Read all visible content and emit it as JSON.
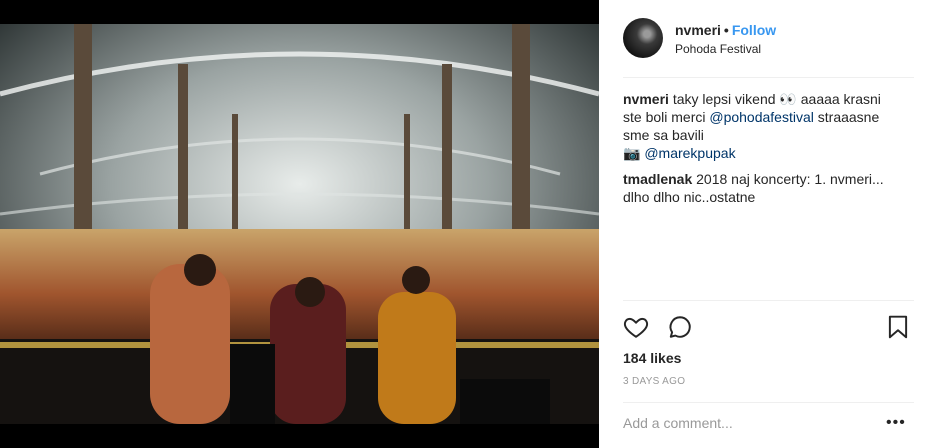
{
  "post": {
    "username": "nvmeri",
    "follow_label": "Follow",
    "separator": "•",
    "location": "Pohoda Festival"
  },
  "caption": {
    "username": "nvmeri",
    "text_1": "taky lepsi vikend 👀 aaaaa krasni ste boli merci ",
    "mention_1": "@pohodafestival",
    "text_2": " straaasne sme sa bavili",
    "camera_glyph": "📷",
    "mention_2": "@marekpupak"
  },
  "comment": {
    "username": "tmadlenak",
    "text": "2018 naj koncerty: 1. nvmeri... dlho dlho nic..ostatne"
  },
  "likes": "184 likes",
  "timestamp": "3 DAYS AGO",
  "add_comment_placeholder": "Add a comment...",
  "more_glyph": "•••",
  "icons": {
    "like": "heart-icon",
    "comment": "comment-icon",
    "save": "bookmark-icon"
  }
}
